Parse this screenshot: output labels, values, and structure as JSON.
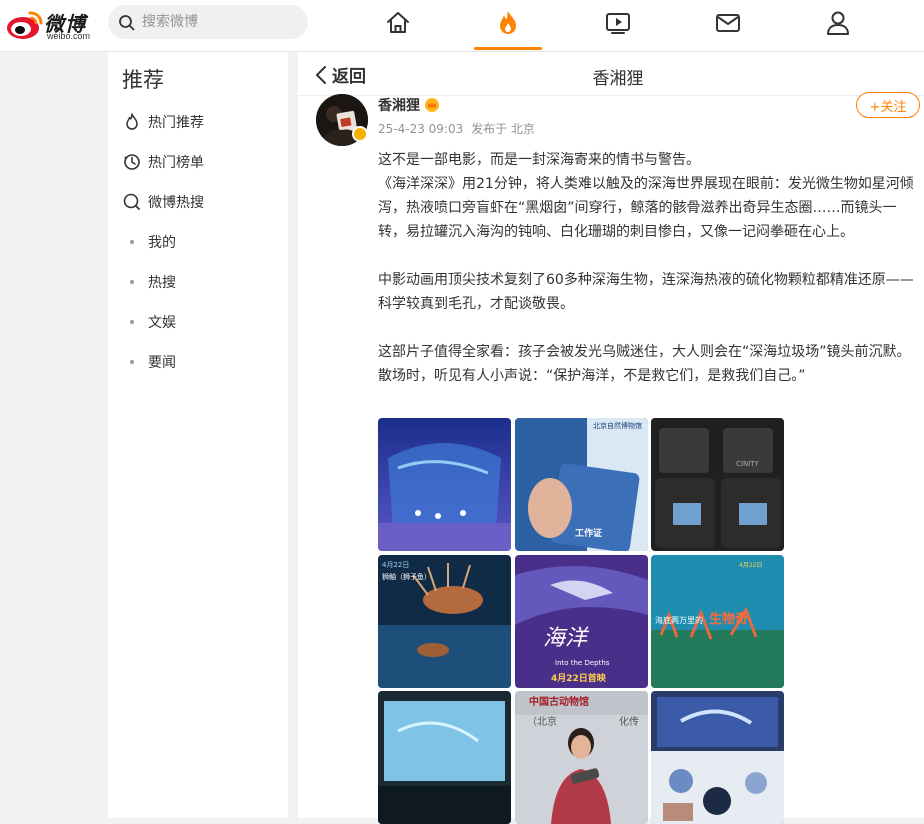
{
  "brand": {
    "name": "微博",
    "domain": "weibo.com",
    "accent": "#ff8200"
  },
  "search": {
    "placeholder": "搜索微博"
  },
  "topnav": [
    "home-icon",
    "hot-icon",
    "video-icon",
    "message-icon",
    "profile-icon"
  ],
  "sidebar": {
    "title": "推荐",
    "items": [
      {
        "label": "热门推荐",
        "icon": "flame-icon"
      },
      {
        "label": "热门榜单",
        "icon": "clock-icon"
      },
      {
        "label": "微博热搜",
        "icon": "search-icon"
      },
      {
        "label": "我的"
      },
      {
        "label": "热搜"
      },
      {
        "label": "文娱"
      },
      {
        "label": "要闻"
      }
    ]
  },
  "header": {
    "back_label": "返回",
    "title": "香湘狸"
  },
  "post": {
    "author": "香湘狸",
    "date": "25-4-23 09:03",
    "location": "发布于 北京",
    "follow_label": "+关注",
    "paragraphs": [
      "这不是一部电影，而是一封深海寄来的情书与警告。",
      "《海洋深深》用21分钟，将人类难以触及的深海世界展现在眼前：发光微生物如星河倾泻，热液喷口旁盲虾在“黑烟囱”间穿行，鲸落的骸骨滋养出奇异生态圈……而镜头一转，易拉罐沉入海沟的钝响、白化珊瑚的刺目惨白，又像一记闷拳砸在心上。",
      "中影动画用顶尖技术复刻了60多种深海生物，连深海热液的硫化物颗粒都精准还原——科学较真到毛孔，才配谈敬畏。",
      "这部片子值得全家看：孩子会被发光乌贼迷住，大人则会在“深海垃圾场”镜头前沉默。散场时，听见有人小声说：“保护海洋，不是救它们，是救我们自己。”"
    ],
    "images": {
      "t2_caption": "北京自然博物馆",
      "t2_card": "工作证",
      "t3_seats": "CINITY",
      "t4_date": "4月22日",
      "t4_label": "狮鲉（狮子鱼）",
      "t5_subtitle": "Into the Depths",
      "t5_date": "4月22日首映",
      "t6_date": "4月22日",
      "t6_text": "海底两万里的",
      "t6_hl": "生物奇",
      "t8_sign": "中国古动物馆",
      "t8_sign2": "（北京",
      "t8_sign3": "化传"
    }
  }
}
